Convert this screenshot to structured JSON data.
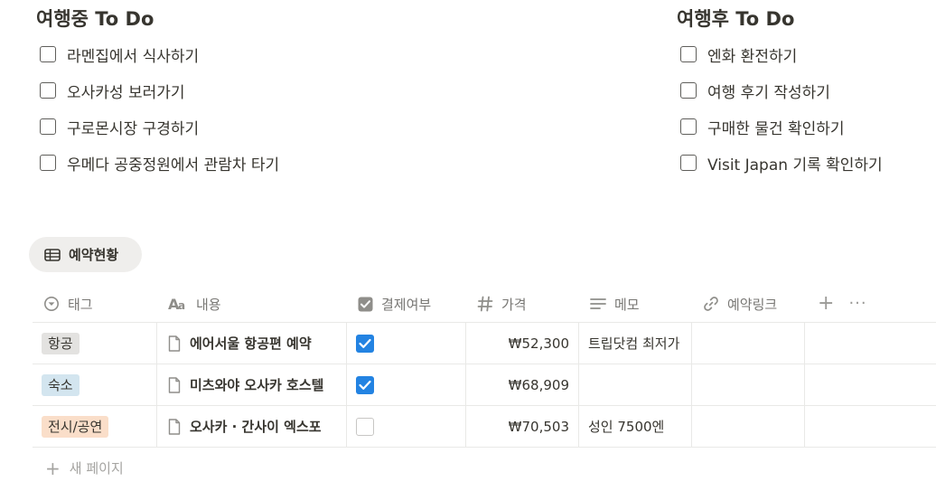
{
  "left_section": {
    "heading": "여행중 To Do",
    "items": [
      {
        "label": "라멘집에서 식사하기",
        "checked": false
      },
      {
        "label": "오사카성 보러가기",
        "checked": false
      },
      {
        "label": "구로몬시장 구경하기",
        "checked": false
      },
      {
        "label": "우메다 공중정원에서 관람차 타기",
        "checked": false
      }
    ]
  },
  "right_section": {
    "heading": "여행후 To Do",
    "items": [
      {
        "label": "엔화 환전하기",
        "checked": false
      },
      {
        "label": "여행 후기 작성하기",
        "checked": false
      },
      {
        "label": "구매한 물건 확인하기",
        "checked": false
      },
      {
        "label": "Visit Japan 기록 확인하기",
        "checked": false
      }
    ]
  },
  "database": {
    "view_tab": {
      "label": "예약현황",
      "icon": "table-icon"
    },
    "columns": [
      {
        "label": "태그",
        "icon": "select-icon"
      },
      {
        "label": "내용",
        "icon": "text-aa-icon"
      },
      {
        "label": "결제여부",
        "icon": "checkbox-icon"
      },
      {
        "label": "가격",
        "icon": "number-hash-icon"
      },
      {
        "label": "메모",
        "icon": "lines-icon"
      },
      {
        "label": "예약링크",
        "icon": "link-icon"
      }
    ],
    "header_actions": {
      "add": "+",
      "more": "···"
    },
    "rows": [
      {
        "tag": "항공",
        "tag_color": "#e3e2e0",
        "name": "에어서울 항공편 예약",
        "paid": true,
        "price": "₩52,300",
        "memo": "트립닷컴 최저가",
        "link": ""
      },
      {
        "tag": "숙소",
        "tag_color": "#d3e5ef",
        "name": "미츠와야 오사카 호스텔",
        "paid": true,
        "price": "₩68,909",
        "memo": "",
        "link": ""
      },
      {
        "tag": "전시/공연",
        "tag_color": "#fadec9",
        "name": "오사카 · 간사이 엑스포",
        "paid": false,
        "price": "₩70,503",
        "memo": "성인 7500엔",
        "link": ""
      }
    ],
    "new_page": {
      "plus": "+",
      "label": "새 페이지"
    }
  },
  "colors": {
    "text": "#37352f",
    "muted": "#787774",
    "checkbox_on": "#2383e2",
    "border": "#e9e9e7",
    "view_tab_bg": "#efeeec"
  }
}
